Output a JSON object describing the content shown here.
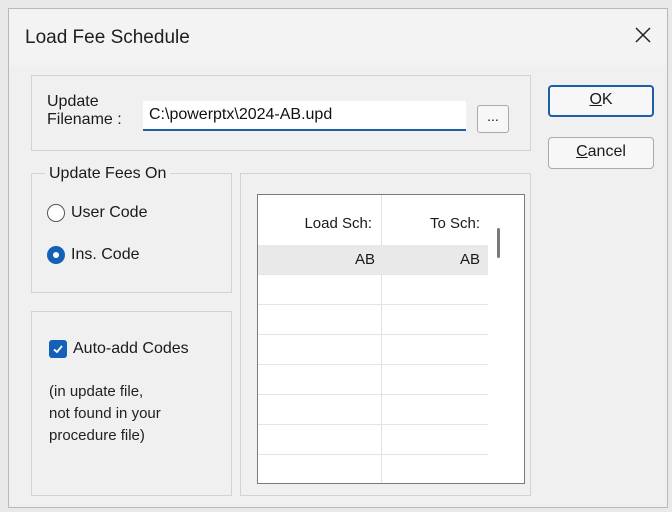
{
  "window": {
    "title": "Load Fee Schedule"
  },
  "file": {
    "label_line1": "Update",
    "label_line2": "Filename :",
    "value": "C:\\powerptx\\2024-AB.upd",
    "browse_label": "..."
  },
  "buttons": {
    "ok_mnemonic": "O",
    "ok_rest": "K",
    "cancel_mnemonic": "C",
    "cancel_rest": "ancel"
  },
  "update_fees": {
    "legend": "Update Fees On",
    "options": [
      {
        "label": "User Code",
        "checked": false
      },
      {
        "label": "Ins. Code",
        "checked": true
      }
    ]
  },
  "auto_add": {
    "label": "Auto-add Codes",
    "checked": true,
    "note_lines": [
      "(in update file,",
      "not found in your",
      "procedure file)"
    ]
  },
  "schedule_grid": {
    "columns": [
      "Load Sch:",
      "To Sch:"
    ],
    "rows": [
      {
        "load": "AB",
        "to": "AB"
      }
    ]
  },
  "colors": {
    "accent": "#1460b8",
    "dialog_bg": "#f0f0f0"
  }
}
